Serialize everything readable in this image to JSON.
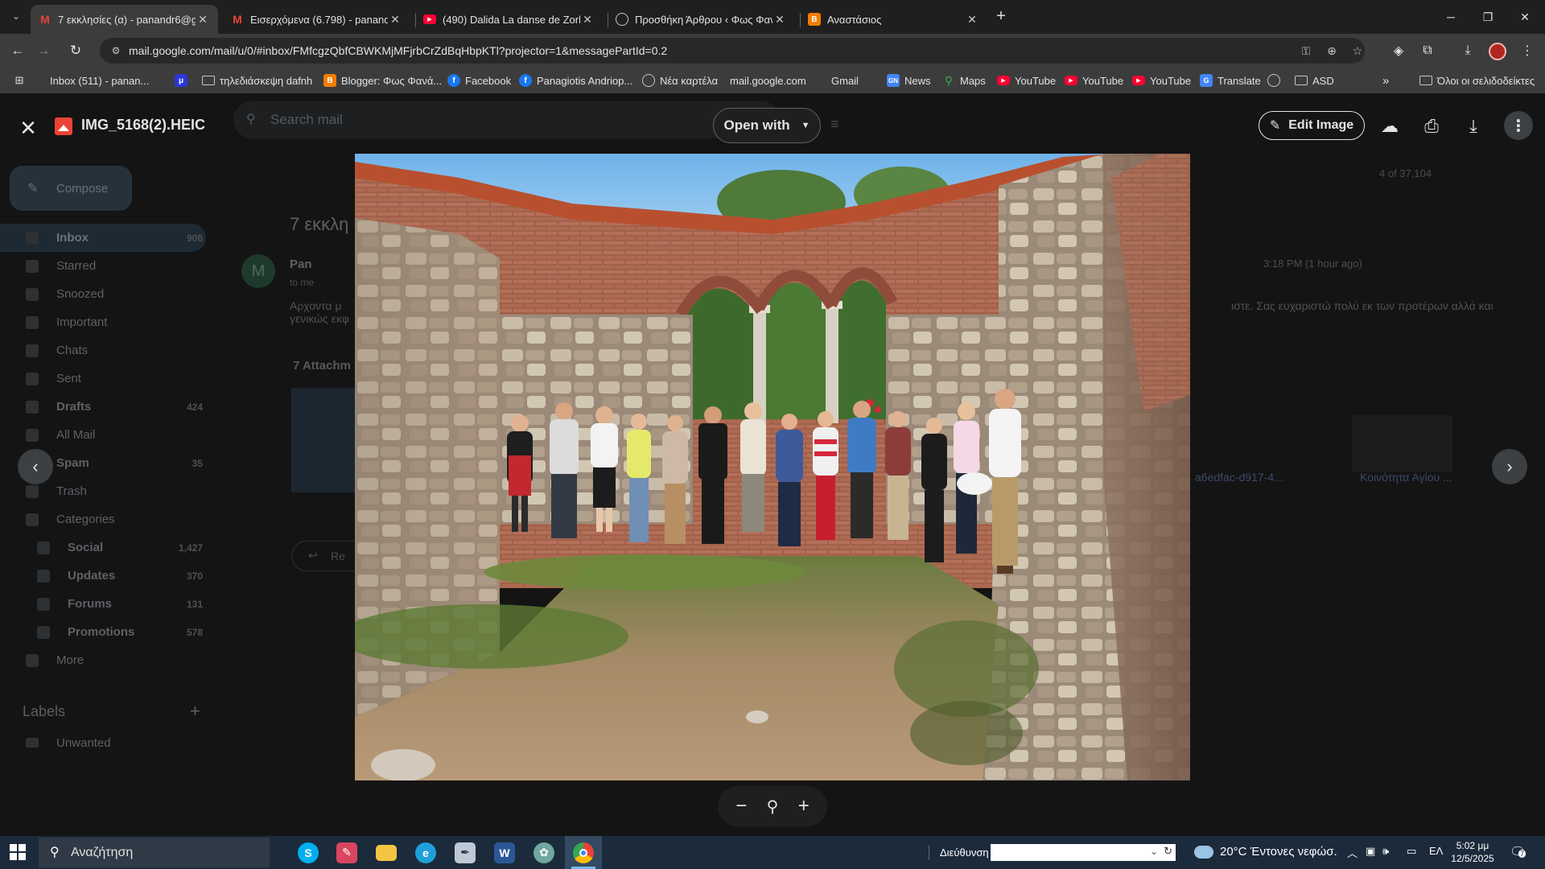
{
  "browser": {
    "tabs": [
      {
        "title": "7 εκκλησίες (α) - panandr6@gmail.com",
        "favicon": "gmail-icon",
        "active": true
      },
      {
        "title": "Εισερχόμενα (6.798) - panandr6",
        "favicon": "gmail-icon",
        "active": false
      },
      {
        "title": "(490) Dalida La danse de Zorba",
        "favicon": "youtube-icon",
        "active": false
      },
      {
        "title": "Προσθήκη Άρθρου ‹ Φως Φανάρι",
        "favicon": "globe-icon",
        "active": false
      },
      {
        "title": "Αναστάσιος",
        "favicon": "blogger-icon",
        "active": false
      }
    ],
    "url": "mail.google.com/mail/u/0/#inbox/FMfcgzQbfCBWKMjMFjrbCrZdBqHbpKTl?projector=1&messagePartId=0.2",
    "bookmarks": [
      {
        "label": "Inbox (511) - panan...",
        "icon": "gmail-icon"
      },
      {
        "label": "",
        "icon": "mu-icon"
      },
      {
        "label": "τηλεδιάσκεψη dafnh",
        "icon": "folder-icon"
      },
      {
        "label": "Blogger: Φως Φανά...",
        "icon": "blogger-icon"
      },
      {
        "label": "Facebook",
        "icon": "facebook-icon"
      },
      {
        "label": "Panagiotis Andriop...",
        "icon": "facebook-icon"
      },
      {
        "label": "Νέα καρτέλα",
        "icon": "globe-icon"
      },
      {
        "label": "mail.google.com",
        "icon": "gmail-icon"
      },
      {
        "label": "Gmail",
        "icon": "gmail-icon"
      },
      {
        "label": "News",
        "icon": "news-icon"
      },
      {
        "label": "Maps",
        "icon": "maps-icon"
      },
      {
        "label": "YouTube",
        "icon": "youtube-icon"
      },
      {
        "label": "YouTube",
        "icon": "youtube-icon"
      },
      {
        "label": "YouTube",
        "icon": "youtube-icon"
      },
      {
        "label": "Translate",
        "icon": "translate-icon"
      },
      {
        "label": "",
        "icon": "globe-icon"
      },
      {
        "label": "ASD",
        "icon": "folder-icon"
      }
    ],
    "all_bookmarks": "Όλοι οι σελιδοδείκτες"
  },
  "gmail": {
    "search_placeholder": "Search mail",
    "compose": "Compose",
    "nav": [
      {
        "label": "Inbox",
        "count": "908"
      },
      {
        "label": "Starred",
        "count": ""
      },
      {
        "label": "Snoozed",
        "count": ""
      },
      {
        "label": "Important",
        "count": ""
      },
      {
        "label": "Chats",
        "count": ""
      },
      {
        "label": "Sent",
        "count": ""
      },
      {
        "label": "Drafts",
        "count": "424"
      },
      {
        "label": "All Mail",
        "count": ""
      },
      {
        "label": "Spam",
        "count": "35"
      },
      {
        "label": "Trash",
        "count": ""
      },
      {
        "label": "Categories",
        "count": ""
      },
      {
        "label": "Social",
        "count": "1,427"
      },
      {
        "label": "Updates",
        "count": "370"
      },
      {
        "label": "Forums",
        "count": "131"
      },
      {
        "label": "Promotions",
        "count": "578"
      },
      {
        "label": "More",
        "count": ""
      }
    ],
    "labels_heading": "Labels",
    "labels": [
      "Unwanted"
    ],
    "subject": "7 εκκλη",
    "sender": "Pan",
    "sender_initial": "M",
    "to": "to me",
    "time": "3:18 PM (1 hour ago)",
    "pager": "4 of 37,104",
    "body_start": "Αρχοντα μ",
    "body_start_2": "γενικώς εκφ",
    "body_end": "ιστε.  Σας ευχαριστώ πολύ εκ των προτέρων αλλά και",
    "attachments_heading": "7 Attachm",
    "attachment_2": "a6edfac-d917-4...",
    "attachment_3": "Κοινότητα Αγίου ...",
    "reply": "Re"
  },
  "viewer": {
    "filename": "IMG_5168(2).HEIC",
    "open_with": "Open with",
    "edit_image": "Edit Image"
  },
  "taskbar": {
    "search_placeholder": "Αναζήτηση",
    "address_label": "Διεύθυνση",
    "weather": "20°C  Έντονες νεφώσ.",
    "language": "ΕΛ",
    "time": "5:02 μμ",
    "date": "12/5/2025",
    "notifications": "7"
  }
}
